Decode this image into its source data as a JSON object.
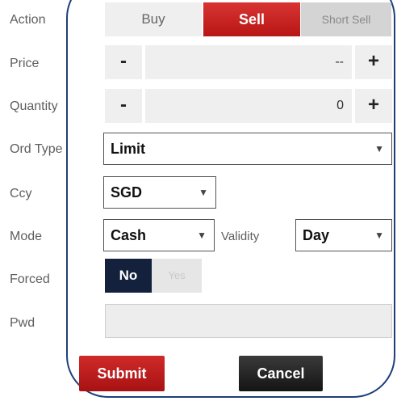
{
  "labels": {
    "action": "Action",
    "price": "Price",
    "quantity": "Quantity",
    "ord_type": "Ord Type",
    "ccy": "Ccy",
    "mode": "Mode",
    "forced": "Forced",
    "pwd": "Pwd",
    "validity": "Validity"
  },
  "action": {
    "buy": "Buy",
    "sell": "Sell",
    "short_sell": "Short Sell",
    "selected": "Sell"
  },
  "price": {
    "minus": "-",
    "value": "--",
    "plus": "+"
  },
  "quantity": {
    "minus": "-",
    "value": "0",
    "plus": "+"
  },
  "ord_type": {
    "value": "Limit"
  },
  "ccy": {
    "value": "SGD"
  },
  "mode": {
    "value": "Cash"
  },
  "validity": {
    "value": "Day"
  },
  "forced": {
    "no": "No",
    "yes": "Yes",
    "selected": "No"
  },
  "pwd": {
    "value": ""
  },
  "buttons": {
    "submit": "Submit",
    "cancel": "Cancel"
  },
  "colors": {
    "sell_red": "#c41f1f",
    "forced_navy": "#14213d",
    "outline_blue": "#1e3f7a"
  },
  "icons": {
    "caret": "chevron-down-icon"
  }
}
